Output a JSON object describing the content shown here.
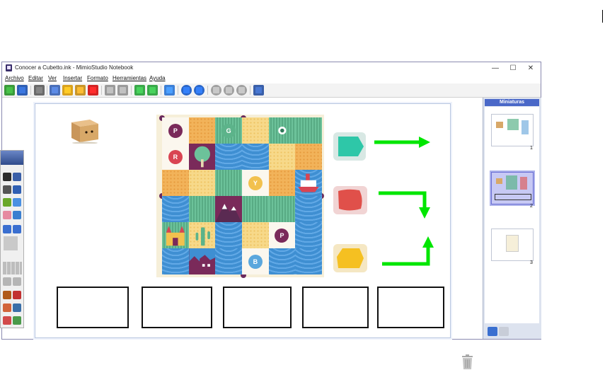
{
  "window": {
    "title": "Conocer a Cubetto.ink - MimioStudio Notebook",
    "controls": {
      "minimize": "—",
      "maximize": "☐",
      "close": "✕"
    }
  },
  "menu": {
    "items": [
      "Archivo",
      "Editar",
      "Ver",
      "Insertar",
      "Formato",
      "Herramientas",
      "Ayuda"
    ]
  },
  "toolbar": {
    "icons": [
      "home-icon",
      "save-icon",
      "print-icon",
      "cut-icon",
      "copy-icon",
      "paste-icon",
      "delete-icon",
      "undo-icon",
      "redo-icon",
      "new-page-icon",
      "insert-page-icon",
      "users-icon",
      "back-icon",
      "forward-icon",
      "zoom-in-icon",
      "zoom-out-icon",
      "zoom-fit-icon",
      "window-icon"
    ]
  },
  "board": {
    "rows": [
      [
        {
          "t": "w",
          "label": "P",
          "color": "#7a2a5a"
        },
        {
          "t": "o"
        },
        {
          "t": "g",
          "label": "G",
          "color": "#5cb38a"
        },
        {
          "t": "y"
        },
        {
          "t": "g",
          "flower": true
        },
        {
          "t": "g"
        }
      ],
      [
        {
          "t": "w",
          "label": "R",
          "color": "#d94452"
        },
        {
          "t": "p",
          "tree": true
        },
        {
          "t": "b"
        },
        {
          "t": "b"
        },
        {
          "t": "y"
        },
        {
          "t": "o"
        }
      ],
      [
        {
          "t": "o"
        },
        {
          "t": "y"
        },
        {
          "t": "g"
        },
        {
          "t": "w",
          "label": "Y",
          "color": "#f2c14e"
        },
        {
          "t": "o"
        },
        {
          "t": "b",
          "boat": true
        }
      ],
      [
        {
          "t": "b"
        },
        {
          "t": "g"
        },
        {
          "t": "p",
          "mountain": true
        },
        {
          "t": "g"
        },
        {
          "t": "g"
        },
        {
          "t": "b"
        }
      ],
      [
        {
          "t": "g",
          "castle": true
        },
        {
          "t": "y",
          "cactus": true
        },
        {
          "t": "b"
        },
        {
          "t": "y"
        },
        {
          "t": "w",
          "label": "P",
          "color": "#7a2a5a"
        },
        {
          "t": "b"
        }
      ],
      [
        {
          "t": "b"
        },
        {
          "t": "p",
          "city": true
        },
        {
          "t": "b"
        },
        {
          "t": "w",
          "label": "B",
          "color": "#5aa7dd"
        },
        {
          "t": "b"
        },
        {
          "t": "b"
        }
      ]
    ]
  },
  "instructions": {
    "tiles": [
      {
        "name": "forward",
        "color": "#2ec7a8"
      },
      {
        "name": "right",
        "color": "#e0504a"
      },
      {
        "name": "left",
        "color": "#f5c021"
      }
    ],
    "arrow_color": "#00e600"
  },
  "answer_boxes": 5,
  "thumbnails": {
    "header": "Miniaturas",
    "pages": [
      {
        "num": "1",
        "selected": false
      },
      {
        "num": "2",
        "selected": true
      },
      {
        "num": "3",
        "selected": false
      }
    ]
  }
}
